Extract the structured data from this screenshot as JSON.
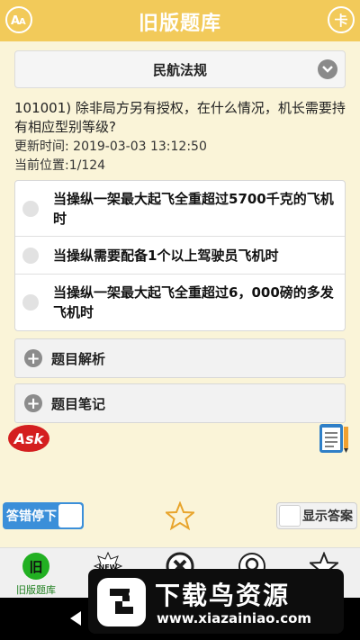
{
  "header": {
    "title": "旧版题库",
    "left_icon_text": "A",
    "right_icon_text": "卡"
  },
  "category": {
    "label": "民航法规"
  },
  "question": {
    "text": "101001) 除非局方另有授权，在什么情况，机长需要持有相应型别等级?",
    "updated": "更新时间: 2019-03-03 13:12:50",
    "position": "当前位置:1/124"
  },
  "options": [
    {
      "text": "当操纵一架最大起飞全重超过5700千克的飞机时"
    },
    {
      "text": "当操纵需要配备1个以上驾驶员飞机时"
    },
    {
      "text": "当操纵一架最大起飞全重超过6，000磅的多发飞机时"
    }
  ],
  "panels": {
    "analysis_label": "题目解析",
    "notes_label": "题目笔记"
  },
  "ask_logo_text": "Ask",
  "controls": {
    "stop_on_error_label": "答错停下",
    "show_answer_label": "显示答案"
  },
  "tabs": [
    {
      "label": "旧版题库",
      "icon": "old-bank-icon"
    },
    {
      "label": "新",
      "icon": "new-badge-icon"
    },
    {
      "label": "",
      "icon": "close-circle-icon"
    },
    {
      "label": "",
      "icon": "search-circle-icon"
    },
    {
      "label": "",
      "icon": "star-icon"
    }
  ],
  "watermark": {
    "main": "下载鸟资源",
    "url": "www.xiazainiao.com"
  },
  "colors": {
    "header": "#f2ca5a",
    "background": "#faf4d8",
    "toggle": "#3b8fd9",
    "active_tab": "#1e7f1e"
  }
}
